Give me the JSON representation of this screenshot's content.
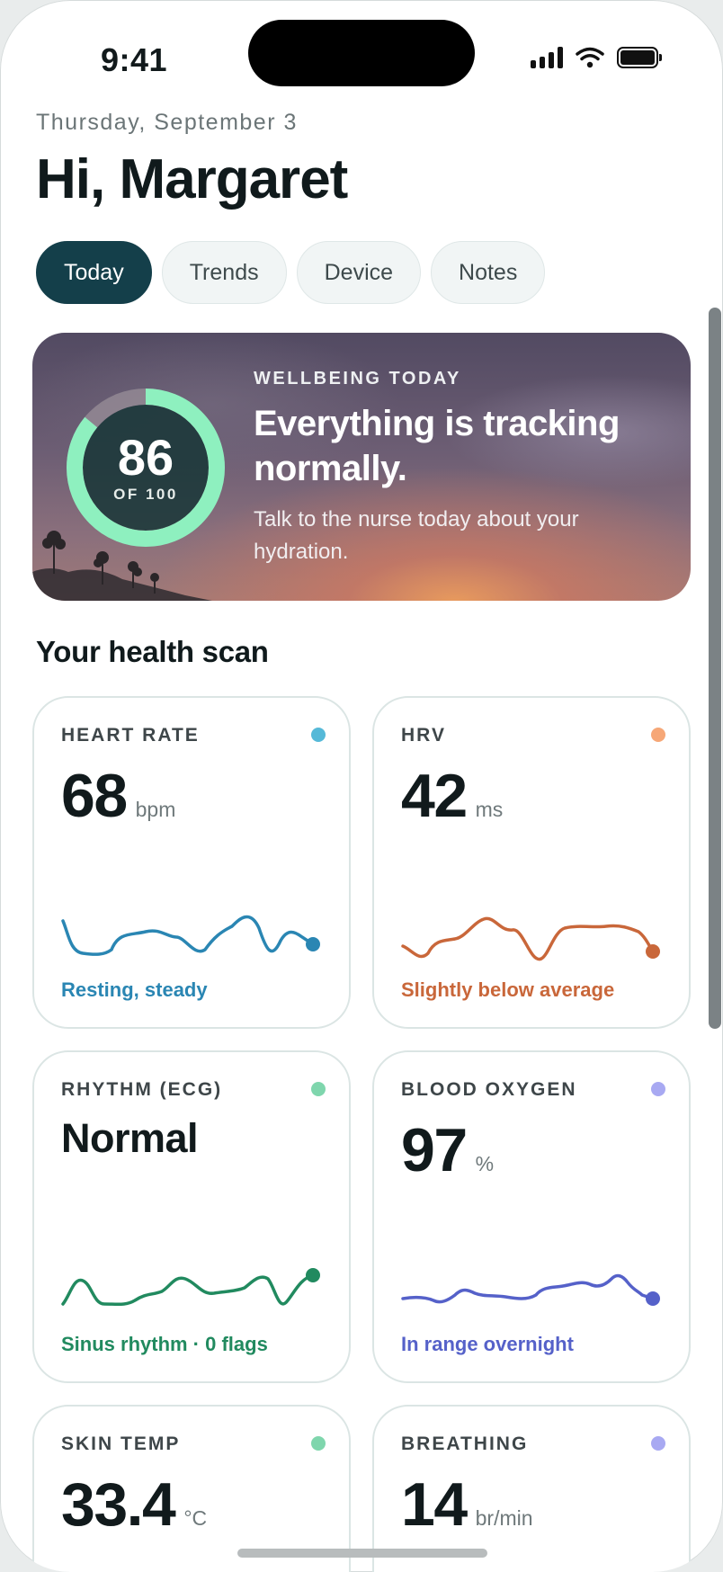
{
  "status_bar": {
    "time": "9:41"
  },
  "header": {
    "date": "Thursday, September 3",
    "greeting": "Hi, Margaret"
  },
  "tabs": [
    {
      "label": "Today",
      "active": true
    },
    {
      "label": "Trends",
      "active": false
    },
    {
      "label": "Device",
      "active": false
    },
    {
      "label": "Notes",
      "active": false
    }
  ],
  "hero": {
    "score": "86",
    "score_of": "OF 100",
    "score_fraction": 0.86,
    "kicker": "WELLBEING TODAY",
    "title": "Everything is tracking normally.",
    "body": "Talk to the nurse today about your hydration.",
    "ring_color": "#8ef0bf"
  },
  "section_title": "Your health scan",
  "cards": [
    {
      "label": "HEART RATE",
      "value": "68",
      "unit": "bpm",
      "status": "Resting, steady",
      "dot_color": "#55b9d8",
      "line_color": "#2a86b3"
    },
    {
      "label": "HRV",
      "value": "42",
      "unit": "ms",
      "status": "Slightly below average",
      "dot_color": "#f6a777",
      "line_color": "#c9673a"
    },
    {
      "label": "RHYTHM (ECG)",
      "value": "Normal",
      "unit": "",
      "status": "Sinus rhythm · 0 flags",
      "dot_color": "#7fd6ad",
      "line_color": "#218a5f"
    },
    {
      "label": "BLOOD OXYGEN",
      "value": "97",
      "unit": "%",
      "status": "In range overnight",
      "dot_color": "#a8a9f2",
      "line_color": "#5561c9"
    },
    {
      "label": "SKIN TEMP",
      "value": "33.4",
      "unit": "°C",
      "status": "",
      "dot_color": "#7fd6ad",
      "line_color": "#218a5f"
    },
    {
      "label": "BREATHING",
      "value": "14",
      "unit": "br/min",
      "status": "",
      "dot_color": "#a8a9f2",
      "line_color": "#5561c9"
    }
  ]
}
